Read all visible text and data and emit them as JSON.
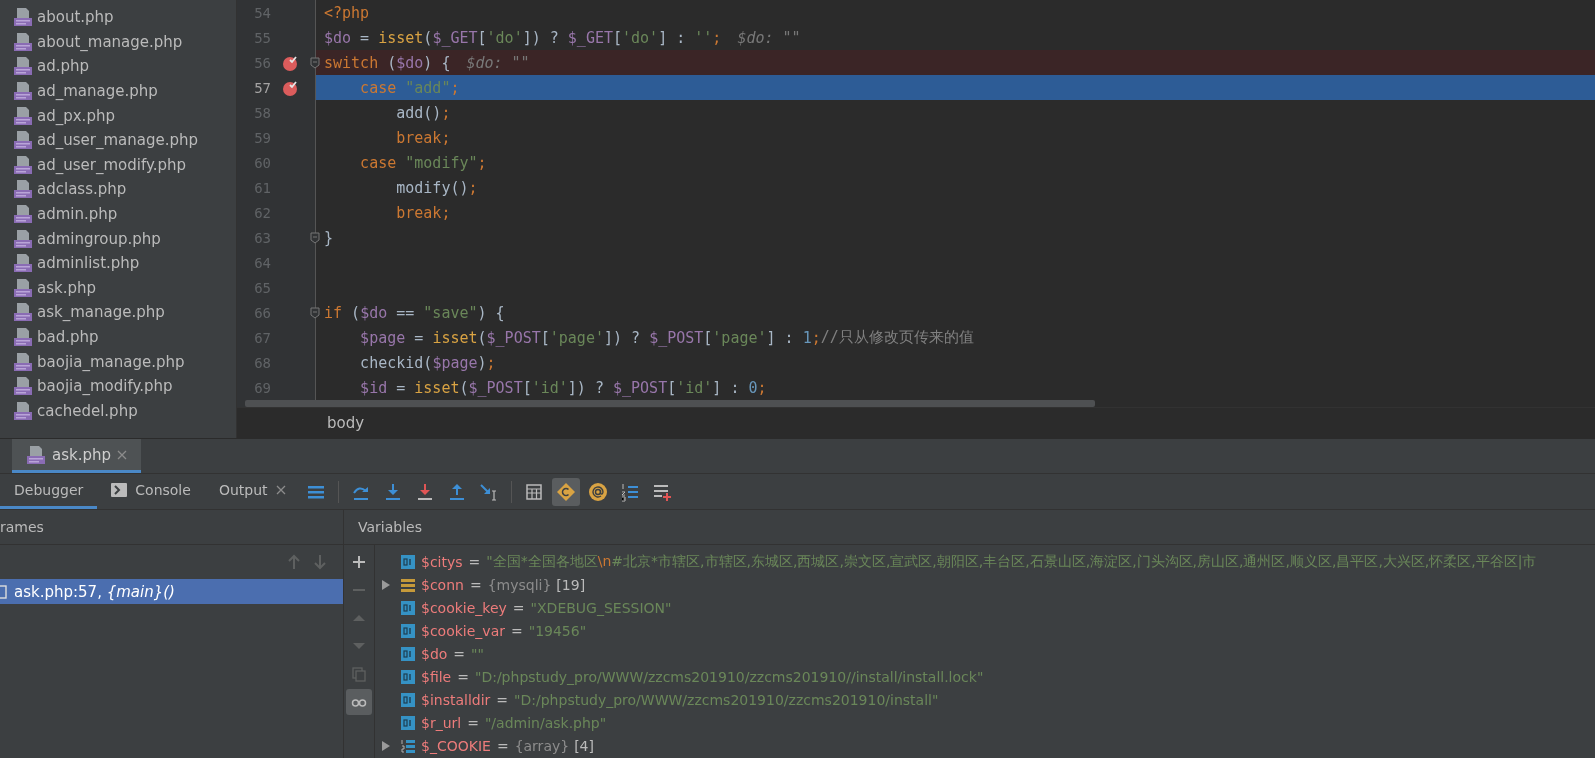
{
  "project_files": [
    {
      "name": "about.php"
    },
    {
      "name": "about_manage.php"
    },
    {
      "name": "ad.php"
    },
    {
      "name": "ad_manage.php"
    },
    {
      "name": "ad_px.php"
    },
    {
      "name": "ad_user_manage.php"
    },
    {
      "name": "ad_user_modify.php"
    },
    {
      "name": "adclass.php"
    },
    {
      "name": "admin.php"
    },
    {
      "name": "admingroup.php"
    },
    {
      "name": "adminlist.php"
    },
    {
      "name": "ask.php"
    },
    {
      "name": "ask_manage.php"
    },
    {
      "name": "bad.php"
    },
    {
      "name": "baojia_manage.php"
    },
    {
      "name": "baojia_modify.php"
    },
    {
      "name": "cachedel.php"
    }
  ],
  "editor": {
    "lines": [
      {
        "number": "54",
        "breakpoint": false,
        "current": false,
        "fold": false,
        "tokens": [
          {
            "kind": "keyword",
            "text": "<?php"
          }
        ]
      },
      {
        "number": "55",
        "breakpoint": false,
        "current": false,
        "fold": false,
        "tokens": [
          {
            "kind": "var",
            "text": "$do"
          },
          {
            "kind": "plain",
            "text": " = "
          },
          {
            "kind": "builtin",
            "text": "isset"
          },
          {
            "kind": "plain",
            "text": "("
          },
          {
            "kind": "var",
            "text": "$_GET"
          },
          {
            "kind": "plain",
            "text": "["
          },
          {
            "kind": "string",
            "text": "'do'"
          },
          {
            "kind": "plain",
            "text": "]) ? "
          },
          {
            "kind": "var",
            "text": "$_GET"
          },
          {
            "kind": "plain",
            "text": "["
          },
          {
            "kind": "string",
            "text": "'do'"
          },
          {
            "kind": "plain",
            "text": "] : "
          },
          {
            "kind": "string",
            "text": "''"
          },
          {
            "kind": "keyword",
            "text": ";"
          },
          {
            "kind": "hint",
            "text": "$do: \"\""
          }
        ]
      },
      {
        "number": "56",
        "breakpoint": true,
        "current": false,
        "fold": true,
        "tokens": [
          {
            "kind": "keyword",
            "text": "switch"
          },
          {
            "kind": "plain",
            "text": " ("
          },
          {
            "kind": "var",
            "text": "$do"
          },
          {
            "kind": "plain",
            "text": ") {"
          },
          {
            "kind": "hint",
            "text": "$do: \"\""
          }
        ]
      },
      {
        "number": "57",
        "breakpoint": true,
        "current": true,
        "fold": false,
        "tokens": [
          {
            "kind": "keyword",
            "text": "    case"
          },
          {
            "kind": "string",
            "text": " \"add\""
          },
          {
            "kind": "keyword",
            "text": ";"
          }
        ]
      },
      {
        "number": "58",
        "breakpoint": false,
        "current": false,
        "fold": false,
        "tokens": [
          {
            "kind": "plain",
            "text": "        add()"
          },
          {
            "kind": "keyword",
            "text": ";"
          }
        ]
      },
      {
        "number": "59",
        "breakpoint": false,
        "current": false,
        "fold": false,
        "tokens": [
          {
            "kind": "keyword",
            "text": "        break;"
          }
        ]
      },
      {
        "number": "60",
        "breakpoint": false,
        "current": false,
        "fold": false,
        "tokens": [
          {
            "kind": "keyword",
            "text": "    case"
          },
          {
            "kind": "string",
            "text": " \"modify\""
          },
          {
            "kind": "keyword",
            "text": ";"
          }
        ]
      },
      {
        "number": "61",
        "breakpoint": false,
        "current": false,
        "fold": false,
        "tokens": [
          {
            "kind": "plain",
            "text": "        modify()"
          },
          {
            "kind": "keyword",
            "text": ";"
          }
        ]
      },
      {
        "number": "62",
        "breakpoint": false,
        "current": false,
        "fold": false,
        "tokens": [
          {
            "kind": "keyword",
            "text": "        break;"
          }
        ]
      },
      {
        "number": "63",
        "breakpoint": false,
        "current": false,
        "fold": true,
        "tokens": [
          {
            "kind": "plain",
            "text": "}"
          }
        ]
      },
      {
        "number": "64",
        "breakpoint": false,
        "current": false,
        "fold": false
      },
      {
        "number": "65",
        "breakpoint": false,
        "current": false,
        "fold": false
      },
      {
        "number": "66",
        "breakpoint": false,
        "current": false,
        "fold": true,
        "tokens": [
          {
            "kind": "keyword",
            "text": "if"
          },
          {
            "kind": "plain",
            "text": " ("
          },
          {
            "kind": "var",
            "text": "$do"
          },
          {
            "kind": "plain",
            "text": " == "
          },
          {
            "kind": "string",
            "text": "\"save\""
          },
          {
            "kind": "plain",
            "text": ") {"
          }
        ]
      },
      {
        "number": "67",
        "breakpoint": false,
        "current": false,
        "fold": false,
        "tokens": [
          {
            "kind": "var",
            "text": "    $page"
          },
          {
            "kind": "plain",
            "text": " = "
          },
          {
            "kind": "builtin",
            "text": "isset"
          },
          {
            "kind": "plain",
            "text": "("
          },
          {
            "kind": "var",
            "text": "$_POST"
          },
          {
            "kind": "plain",
            "text": "["
          },
          {
            "kind": "string",
            "text": "'page'"
          },
          {
            "kind": "plain",
            "text": "]) ? "
          },
          {
            "kind": "var",
            "text": "$_POST"
          },
          {
            "kind": "plain",
            "text": "["
          },
          {
            "kind": "string",
            "text": "'page'"
          },
          {
            "kind": "plain",
            "text": "] : "
          },
          {
            "kind": "number",
            "text": "1"
          },
          {
            "kind": "keyword",
            "text": ";"
          },
          {
            "kind": "comment",
            "text": "//只从修改页传来的值"
          }
        ]
      },
      {
        "number": "68",
        "breakpoint": false,
        "current": false,
        "fold": false,
        "tokens": [
          {
            "kind": "plain",
            "text": "    checkid("
          },
          {
            "kind": "var",
            "text": "$page"
          },
          {
            "kind": "plain",
            "text": ")"
          },
          {
            "kind": "keyword",
            "text": ";"
          }
        ]
      },
      {
        "number": "69",
        "breakpoint": false,
        "current": false,
        "fold": false,
        "tokens": [
          {
            "kind": "var",
            "text": "    $id"
          },
          {
            "kind": "plain",
            "text": " = "
          },
          {
            "kind": "builtin",
            "text": "isset"
          },
          {
            "kind": "plain",
            "text": "("
          },
          {
            "kind": "var",
            "text": "$_POST"
          },
          {
            "kind": "plain",
            "text": "["
          },
          {
            "kind": "string",
            "text": "'id'"
          },
          {
            "kind": "plain",
            "text": "]) ? "
          },
          {
            "kind": "var",
            "text": "$_POST"
          },
          {
            "kind": "plain",
            "text": "["
          },
          {
            "kind": "string",
            "text": "'id'"
          },
          {
            "kind": "plain",
            "text": "] : "
          },
          {
            "kind": "number",
            "text": "0"
          },
          {
            "kind": "keyword",
            "text": ";"
          }
        ]
      }
    ],
    "breadcrumb": "body"
  },
  "debug_tab": {
    "title": "ask.php",
    "selected": true
  },
  "debug_tabs": [
    {
      "label": "Debugger",
      "kind": "text",
      "selected": true
    },
    {
      "label": "Console",
      "kind": "console",
      "selected": false
    },
    {
      "label": "Output",
      "kind": "closable",
      "selected": false
    }
  ],
  "debug_toolbar": [
    {
      "kind": "layout",
      "selected": false
    },
    {
      "kind": "step-over",
      "selected": false
    },
    {
      "kind": "step-into",
      "selected": false
    },
    {
      "kind": "force-step-into",
      "selected": false
    },
    {
      "kind": "step-out",
      "selected": false
    },
    {
      "kind": "run-to-cursor",
      "selected": false
    },
    {
      "kind": "evaluate",
      "selected": false
    },
    {
      "kind": "constants",
      "selected": true
    },
    {
      "kind": "at",
      "selected": false
    },
    {
      "kind": "numbered",
      "selected": false
    },
    {
      "kind": "add-list",
      "selected": false
    }
  ],
  "frames": {
    "title": "rames",
    "items": [
      {
        "file": "ask.php:57,",
        "scope": "{main}()",
        "selected": true
      }
    ]
  },
  "variables": {
    "title": "Variables",
    "side_tools": [
      {
        "kind": "plus",
        "disabled": false,
        "selected": false
      },
      {
        "kind": "minus",
        "disabled": true,
        "selected": false
      },
      {
        "kind": "up",
        "disabled": true,
        "selected": false
      },
      {
        "kind": "down",
        "disabled": true,
        "selected": false
      },
      {
        "kind": "copy",
        "disabled": true,
        "selected": false
      },
      {
        "kind": "glasses",
        "disabled": false,
        "selected": true
      }
    ],
    "items": [
      {
        "kind": "scalar",
        "expandable": false,
        "name": "$citys",
        "op": "=",
        "value": [
          {
            "kind": "string",
            "text": "\"全国*全国各地区"
          },
          {
            "kind": "escape",
            "text": "\\n"
          },
          {
            "kind": "string",
            "text": "#北京*市辖区,市辖区,东城区,西城区,崇文区,宣武区,朝阳区,丰台区,石景山区,海淀区,门头沟区,房山区,通州区,顺义区,昌平区,大兴区,怀柔区,平谷区|市"
          }
        ]
      },
      {
        "kind": "object",
        "expandable": true,
        "name": "$conn",
        "op": "=",
        "value": [
          {
            "kind": "type",
            "text": "{mysqli}"
          },
          {
            "kind": "count",
            "text": "[19]"
          }
        ]
      },
      {
        "kind": "scalar",
        "expandable": false,
        "name": "$cookie_key",
        "op": "=",
        "value": [
          {
            "kind": "string",
            "text": "\"XDEBUG_SESSION\""
          }
        ]
      },
      {
        "kind": "scalar",
        "expandable": false,
        "name": "$cookie_var",
        "op": "=",
        "value": [
          {
            "kind": "string",
            "text": "\"19456\""
          }
        ]
      },
      {
        "kind": "scalar",
        "expandable": false,
        "name": "$do",
        "op": "=",
        "value": [
          {
            "kind": "string",
            "text": "\"\""
          }
        ]
      },
      {
        "kind": "scalar",
        "expandable": false,
        "name": "$file",
        "op": "=",
        "value": [
          {
            "kind": "string",
            "text": "\"D:/phpstudy_pro/WWW/zzcms201910/zzcms201910//install/install.lock\""
          }
        ]
      },
      {
        "kind": "scalar",
        "expandable": false,
        "name": "$installdir",
        "op": "=",
        "value": [
          {
            "kind": "string",
            "text": "\"D:/phpstudy_pro/WWW/zzcms201910/zzcms201910/install\""
          }
        ]
      },
      {
        "kind": "scalar",
        "expandable": false,
        "name": "$r_url",
        "op": "=",
        "value": [
          {
            "kind": "string",
            "text": "\"/admin/ask.php\""
          }
        ]
      },
      {
        "kind": "array",
        "expandable": true,
        "name": "$_COOKIE",
        "op": "=",
        "value": [
          {
            "kind": "type",
            "text": "{array}"
          },
          {
            "kind": "count",
            "text": "[4]"
          }
        ]
      }
    ]
  }
}
